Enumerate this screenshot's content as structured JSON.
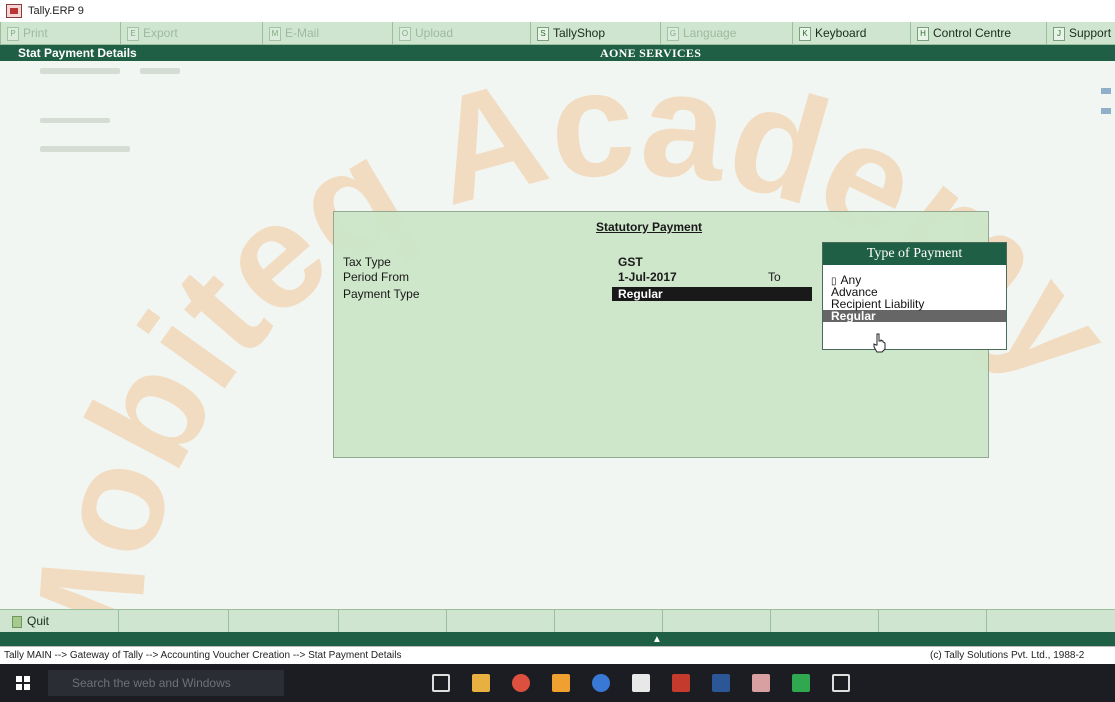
{
  "window": {
    "title": "Tally.ERP 9"
  },
  "top_menu": {
    "items": [
      {
        "label": "Print",
        "key": "P"
      },
      {
        "label": "Export",
        "key": "E"
      },
      {
        "label": "E-Mail",
        "key": "M"
      },
      {
        "label": "Upload",
        "key": "O"
      },
      {
        "label": "TallyShop",
        "key": "S"
      },
      {
        "label": "Language",
        "key": "G"
      },
      {
        "label": "Keyboard",
        "key": "K"
      },
      {
        "label": "Control Centre",
        "key": "H"
      },
      {
        "label": "Support",
        "key": "J"
      }
    ]
  },
  "header": {
    "screen": "Stat Payment Details",
    "company": "AONE SERVICES"
  },
  "form": {
    "title": "Statutory Payment",
    "tax_type_label": "Tax Type",
    "tax_type_value": "GST",
    "period_from_label": "Period From",
    "period_from_value": "1-Jul-2017",
    "to_label": "To",
    "payment_type_label": "Payment Type",
    "payment_type_value": "Regular"
  },
  "popup": {
    "title": "Type of Payment",
    "items": [
      "Any",
      "Advance",
      "Recipient Liability",
      "Regular"
    ],
    "selected": "Regular"
  },
  "buttons": {
    "quit_label": "Quit",
    "quit_key": "Q"
  },
  "status": {
    "breadcrumb": "Tally MAIN --> Gateway of Tally --> Accounting Voucher Creation --> Stat Payment Details",
    "copyright": "(c) Tally Solutions Pvt. Ltd., 1988-2"
  },
  "taskbar": {
    "search_placeholder": "Search the web and Windows"
  },
  "watermark": {
    "text": "Mobiteq Academy"
  },
  "colors": {
    "header_green": "#1f5f46",
    "panel_green": "#cde6c9",
    "menu_green": "#cfe5cf",
    "selection": "#111111"
  }
}
